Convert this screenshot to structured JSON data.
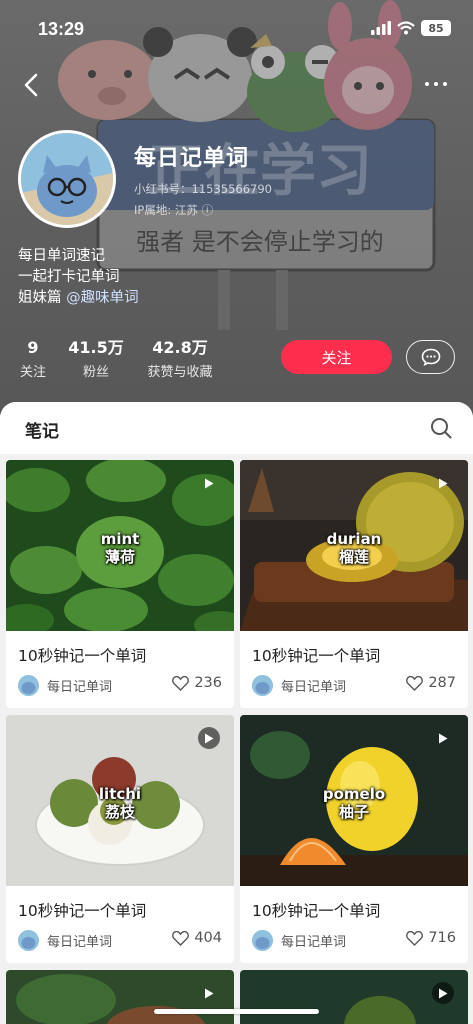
{
  "status_bar": {
    "time": "13:29",
    "battery": "85"
  },
  "profile": {
    "name": "每日记单词",
    "id_line": "小红书号：11535566790",
    "ip_line": "IP属地: 江苏 ⓘ",
    "bio_line1": "每日单词速记",
    "bio_line2": "一起打卡记单词",
    "bio_line3_prefix": "姐妹篇 ",
    "bio_line3_mention": "@趣味单词"
  },
  "banner": {
    "sign_text": "正在学习",
    "sign_subtext": "强者 是不会停止学习的"
  },
  "stats": [
    {
      "value": "9",
      "label": "关注"
    },
    {
      "value": "41.5万",
      "label": "粉丝"
    },
    {
      "value": "42.8万",
      "label": "获赞与收藏"
    }
  ],
  "actions": {
    "follow_label": "关注"
  },
  "notes_section": {
    "title": "笔记"
  },
  "cards": [
    {
      "word_en": "mint",
      "word_zh": "薄荷",
      "title": "10秒钟记一个单词",
      "author": "每日记单词",
      "likes": "236"
    },
    {
      "word_en": "durian",
      "word_zh": "榴莲",
      "title": "10秒钟记一个单词",
      "author": "每日记单词",
      "likes": "287"
    },
    {
      "word_en": "litchi",
      "word_zh": "荔枝",
      "title": "10秒钟记一个单词",
      "author": "每日记单词",
      "likes": "404"
    },
    {
      "word_en": "pomelo",
      "word_zh": "柚子",
      "title": "10秒钟记一个单词",
      "author": "每日记单词",
      "likes": "716"
    }
  ],
  "colors": {
    "accent": "#ff2e4d",
    "header_bg": "#5f5f5f"
  }
}
